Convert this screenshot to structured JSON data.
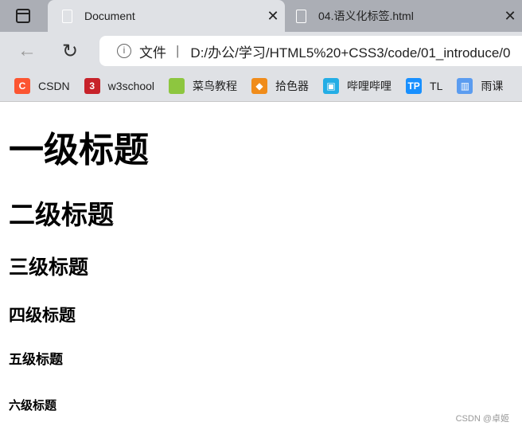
{
  "tabs": [
    {
      "title": "Document",
      "active": true
    },
    {
      "title": "04.语义化标签.html",
      "active": false
    }
  ],
  "address": {
    "label": "文件",
    "url": "D:/办公/学习/HTML5%20+CSS3/code/01_introduce/0"
  },
  "bookmarks": [
    {
      "label": "CSDN",
      "icon": "C",
      "color": "#fc5531"
    },
    {
      "label": "w3school",
      "icon": "3",
      "color": "#c7222a"
    },
    {
      "label": "菜鸟教程",
      "icon": "</>",
      "color": "#8dc63f"
    },
    {
      "label": "拾色器",
      "icon": "◆",
      "color": "#f08c1a"
    },
    {
      "label": "哔哩哔哩",
      "icon": "▣",
      "color": "#23ade5"
    },
    {
      "label": "TL",
      "icon": "TP",
      "color": "#1890ff"
    },
    {
      "label": "雨课",
      "icon": "▥",
      "color": "#5b9cf0"
    }
  ],
  "content": {
    "h1": "一级标题",
    "h2": "二级标题",
    "h3": "三级标题",
    "h4": "四级标题",
    "h5": "五级标题",
    "h6": "六级标题"
  },
  "watermark": "CSDN @卓姬"
}
